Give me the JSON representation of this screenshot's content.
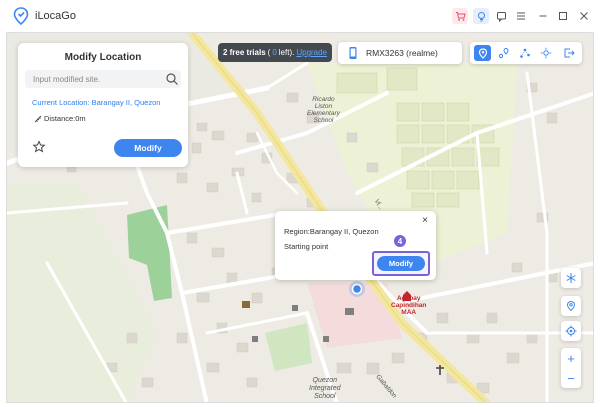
{
  "app": {
    "name": "iLocaGo"
  },
  "panel": {
    "title": "Modify Location",
    "search_placeholder": "Input modified site.",
    "current_location": "Current Location: Barangay II, Quezon",
    "distance": "Distance:0m",
    "modify_label": "Modify"
  },
  "trial": {
    "prefix": "2 free trials",
    "open": "(",
    "count": "0",
    "suffix": "left).",
    "upgrade": "Upgrade"
  },
  "device": {
    "name": "RMX3263 (realme)"
  },
  "popup": {
    "region": "Region:Barangay II, Quezon",
    "starting": "Starting point",
    "modify_label": "Modify",
    "close": "×",
    "step": "4"
  },
  "map_labels": {
    "school1": "Ricardo\nListon\nElementary\nSchool",
    "school2": "Quezon\nIntegrated\nSchool",
    "church": "Aglipay\nCapindihan\nMAA",
    "street1": "Gabaldon",
    "street2": "Vi..."
  },
  "zoom": {
    "in": "+",
    "out": "−"
  },
  "colors": {
    "accent": "#3d85ef",
    "highlight": "#7a63d8",
    "trial_bg": "#444950"
  }
}
